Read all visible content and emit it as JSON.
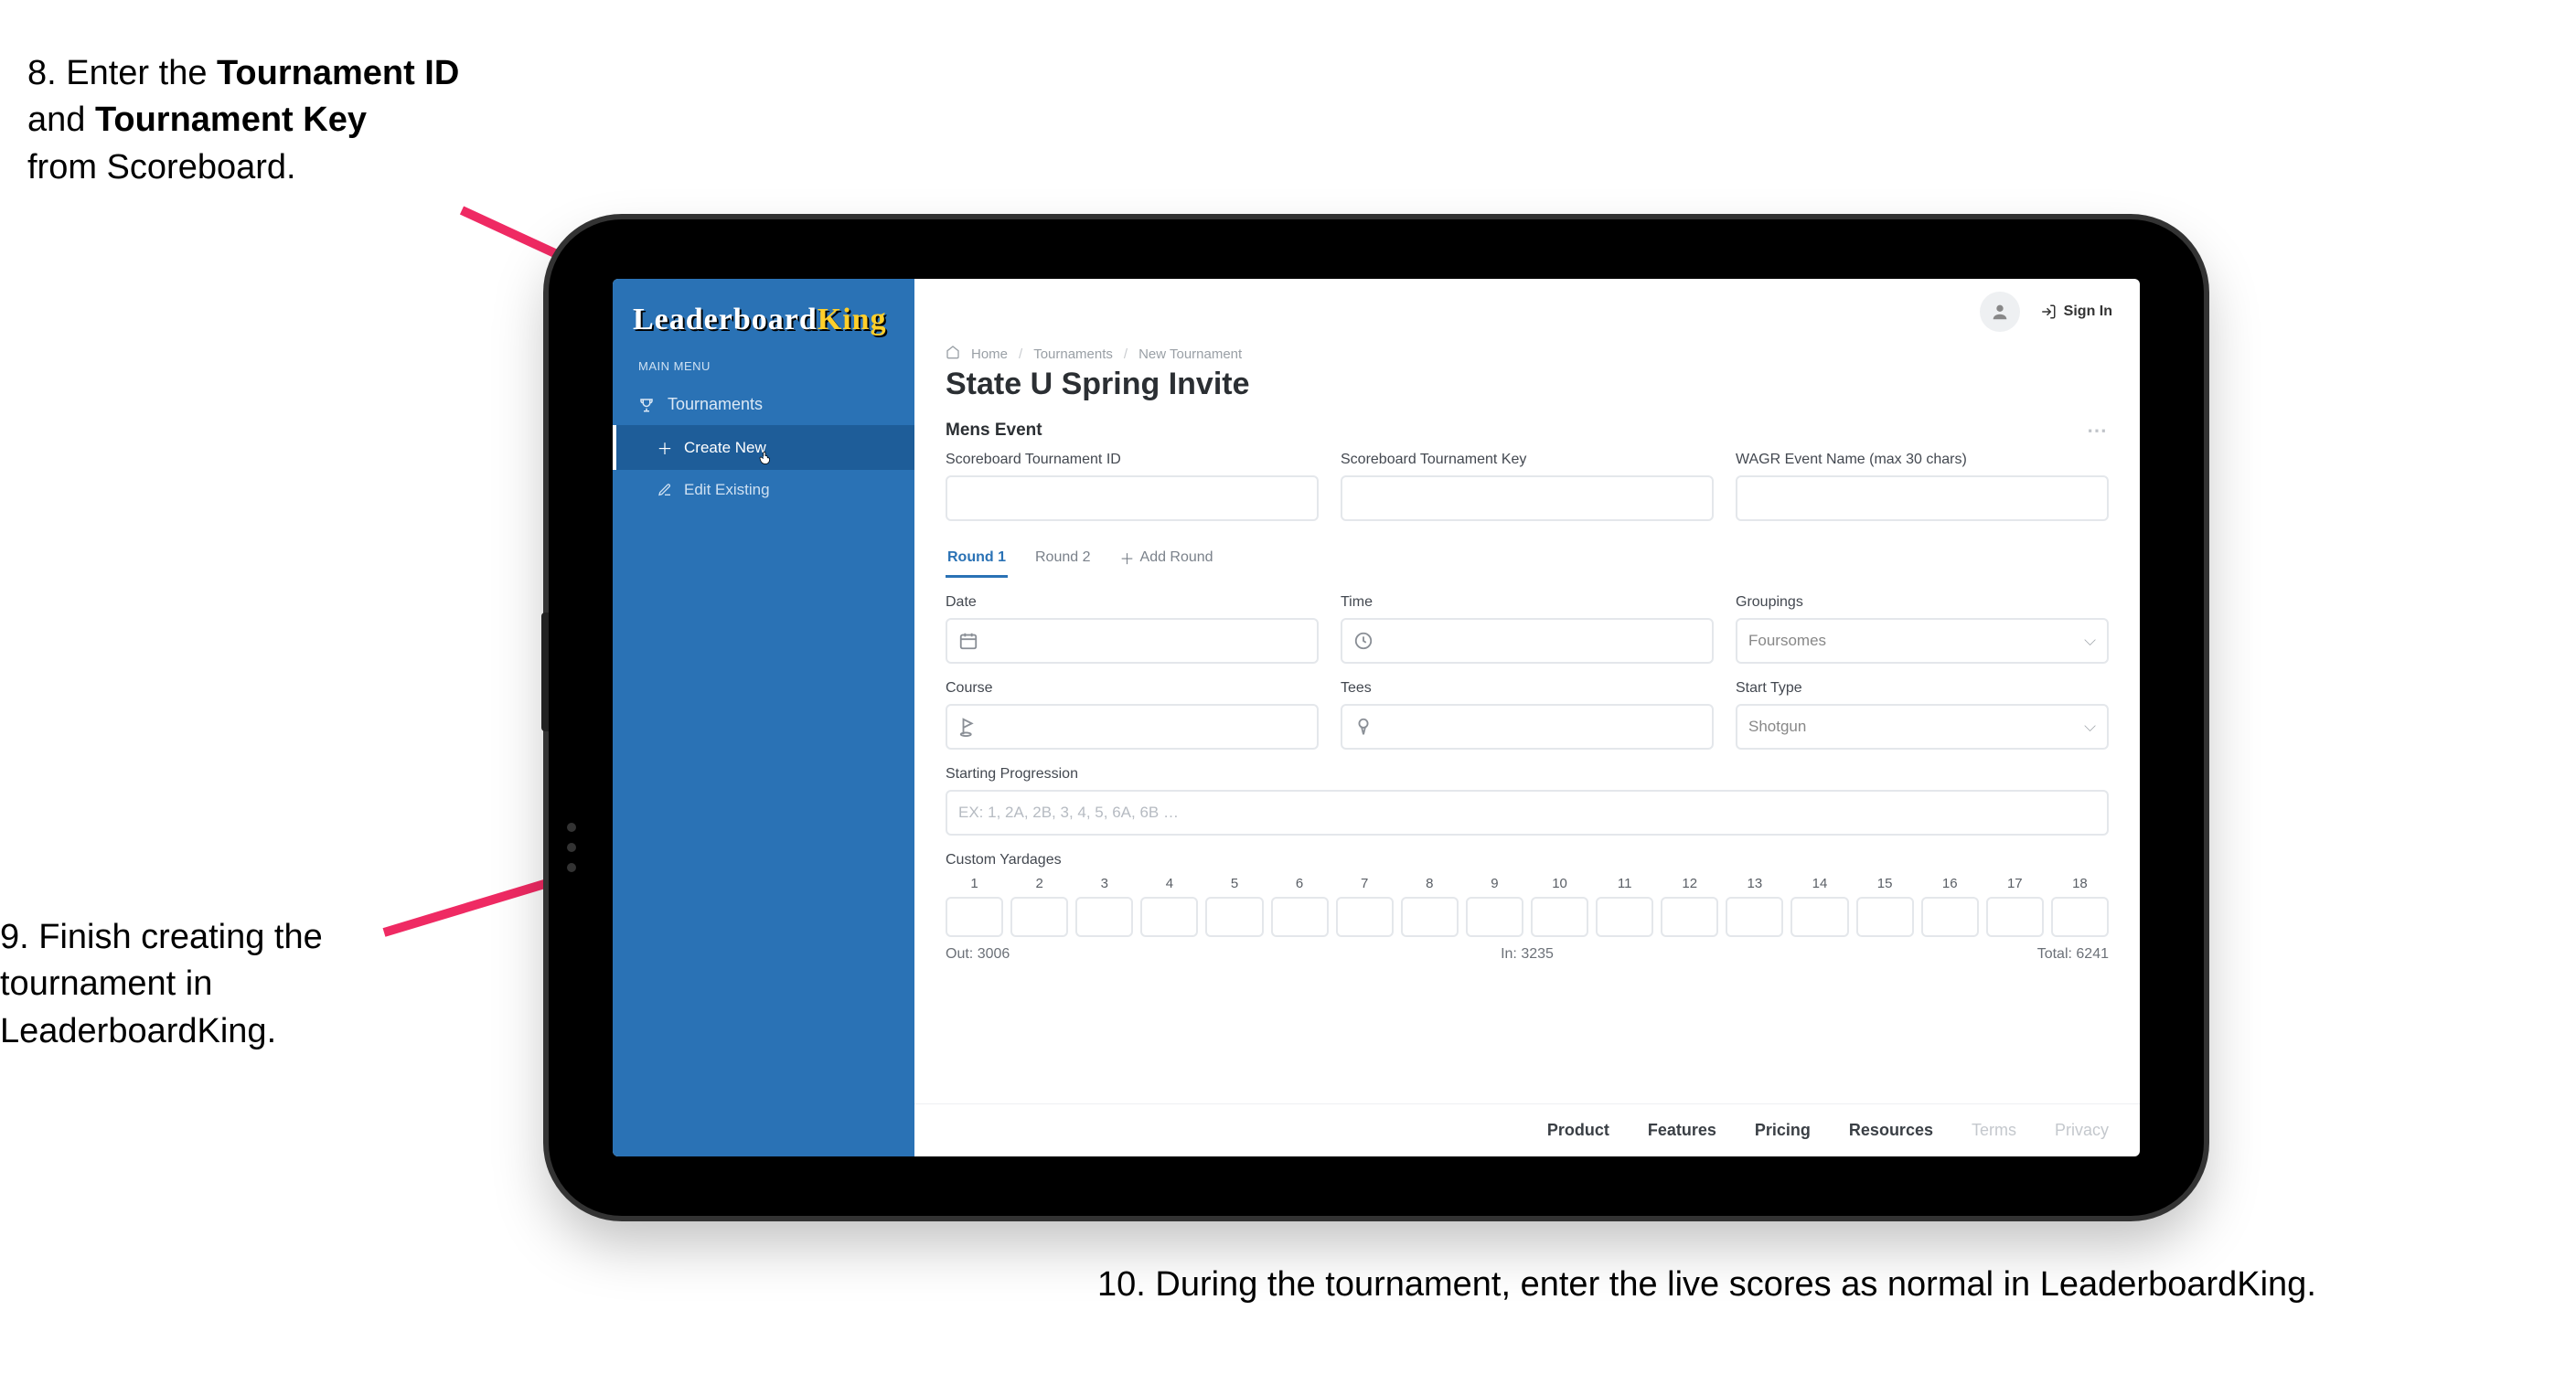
{
  "callouts": {
    "c8_prefix": "8. Enter the ",
    "c8_bold1": "Tournament ID",
    "c8_mid": " and ",
    "c8_bold2": "Tournament Key",
    "c8_suffix": " from Scoreboard.",
    "c9": "9. Finish creating the tournament in LeaderboardKing.",
    "c10": "10. During the tournament, enter the live scores as normal in LeaderboardKing."
  },
  "sidebar": {
    "logo_part1": "Leaderboard",
    "logo_part2": "King",
    "menu_header": "MAIN MENU",
    "tournaments": "Tournaments",
    "create_new": "Create New",
    "edit_existing": "Edit Existing"
  },
  "topbar": {
    "signin": "Sign In"
  },
  "breadcrumb": {
    "home": "Home",
    "tournaments": "Tournaments",
    "new": "New Tournament"
  },
  "page": {
    "title": "State U Spring Invite",
    "section": "Mens Event"
  },
  "fields": {
    "sb_id": "Scoreboard Tournament ID",
    "sb_key": "Scoreboard Tournament Key",
    "wagr": "WAGR Event Name (max 30 chars)",
    "date": "Date",
    "time": "Time",
    "groupings": "Groupings",
    "groupings_value": "Foursomes",
    "course": "Course",
    "tees": "Tees",
    "start_type": "Start Type",
    "start_value": "Shotgun",
    "progression": "Starting Progression",
    "progression_placeholder": "EX: 1, 2A, 2B, 3, 4, 5, 6A, 6B …",
    "custom_yardages": "Custom Yardages"
  },
  "tabs": {
    "r1": "Round 1",
    "r2": "Round 2",
    "add": "Add Round"
  },
  "holes": [
    "1",
    "2",
    "3",
    "4",
    "5",
    "6",
    "7",
    "8",
    "9",
    "10",
    "11",
    "12",
    "13",
    "14",
    "15",
    "16",
    "17",
    "18"
  ],
  "yardage": {
    "out_label": "Out:",
    "out_value": "3006",
    "in_label": "In:",
    "in_value": "3235",
    "total_label": "Total:",
    "total_value": "6241"
  },
  "footer": {
    "product": "Product",
    "features": "Features",
    "pricing": "Pricing",
    "resources": "Resources",
    "terms": "Terms",
    "privacy": "Privacy"
  }
}
